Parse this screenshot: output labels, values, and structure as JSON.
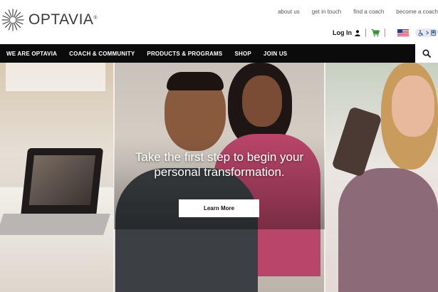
{
  "brand": {
    "name": "OPTAVIA",
    "mark": "®"
  },
  "utility_links": [
    "about us",
    "get in touch",
    "find a coach",
    "become a coach"
  ],
  "account": {
    "login_label": "Log In"
  },
  "icons": {
    "logo": "sunburst-logo-icon",
    "user": "user-icon",
    "cart": "cart-icon",
    "flag": "us-flag-icon",
    "accessibility": "accessibility-icon",
    "search": "search-icon"
  },
  "colors": {
    "nav_bg": "#0b0b0b",
    "cart_green": "#3a8f3a",
    "hero_button_bg": "#ffffff"
  },
  "nav": {
    "items": [
      "WE ARE OPTAVIA",
      "COACH & COMMUNITY",
      "PRODUCTS & PROGRAMS",
      "SHOP",
      "JOIN US"
    ]
  },
  "hero": {
    "headline": "Take the first step to begin your personal transformation.",
    "button_label": "Learn More"
  }
}
